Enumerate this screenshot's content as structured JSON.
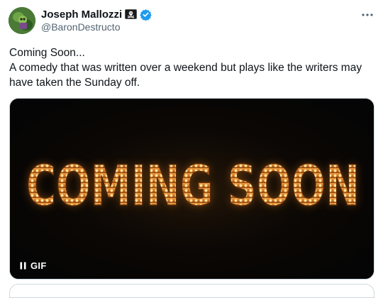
{
  "author": {
    "display_name": "Joseph Mallozzi",
    "handle": "@BaronDestructo",
    "flag_icon": "pirate-flag-icon",
    "verified_icon": "verified-badge-icon",
    "verified_color": "#1d9bf0"
  },
  "more_icon": "more-horizontal-icon",
  "tweet": {
    "line1": "Coming Soon...",
    "line2": "A comedy that was written over a weekend but plays like the writers may",
    "line3": "have taken the Sunday off."
  },
  "media": {
    "type": "GIF",
    "sign_text": "COMING SOON",
    "sign_color": "#e08a2e",
    "gif_label": "GIF",
    "pause_icon": "pause-icon"
  },
  "colors": {
    "text": "#0f1419",
    "secondary": "#536471",
    "media_bg": "#050505",
    "border": "#cfd9de"
  }
}
